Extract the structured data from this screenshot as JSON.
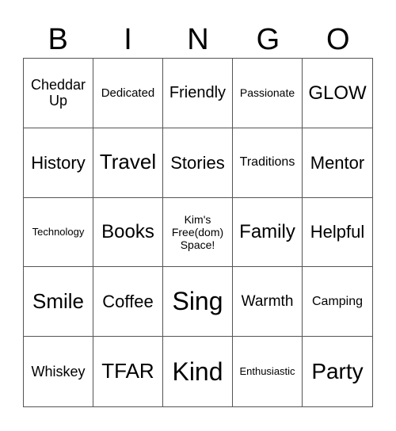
{
  "header": [
    "B",
    "I",
    "N",
    "G",
    "O"
  ],
  "cells": [
    "Cheddar Up",
    "Dedicated",
    "Friendly",
    "Passionate",
    "GLOW",
    "History",
    "Travel",
    "Stories",
    "Traditions",
    "Mentor",
    "Technology",
    "Books",
    "Kim's Free(dom) Space!",
    "Family",
    "Helpful",
    "Smile",
    "Coffee",
    "Sing",
    "Warmth",
    "Camping",
    "Whiskey",
    "TFAR",
    "Kind",
    "Enthusiastic",
    "Party"
  ]
}
